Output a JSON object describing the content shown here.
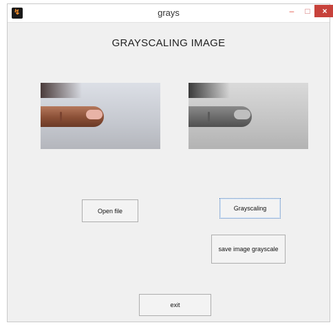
{
  "window": {
    "title": "grays"
  },
  "titlebar_buttons": {
    "minimize": "–",
    "maximize": "□",
    "close": "×"
  },
  "heading": "GRAYSCALING IMAGE",
  "images": {
    "original_icon": "finger-photo",
    "grayscale_icon": "finger-photo-grayscale"
  },
  "buttons": {
    "open_file": "Open file",
    "grayscaling": "Grayscaling",
    "save": "save image grayscale",
    "exit": "exit"
  }
}
